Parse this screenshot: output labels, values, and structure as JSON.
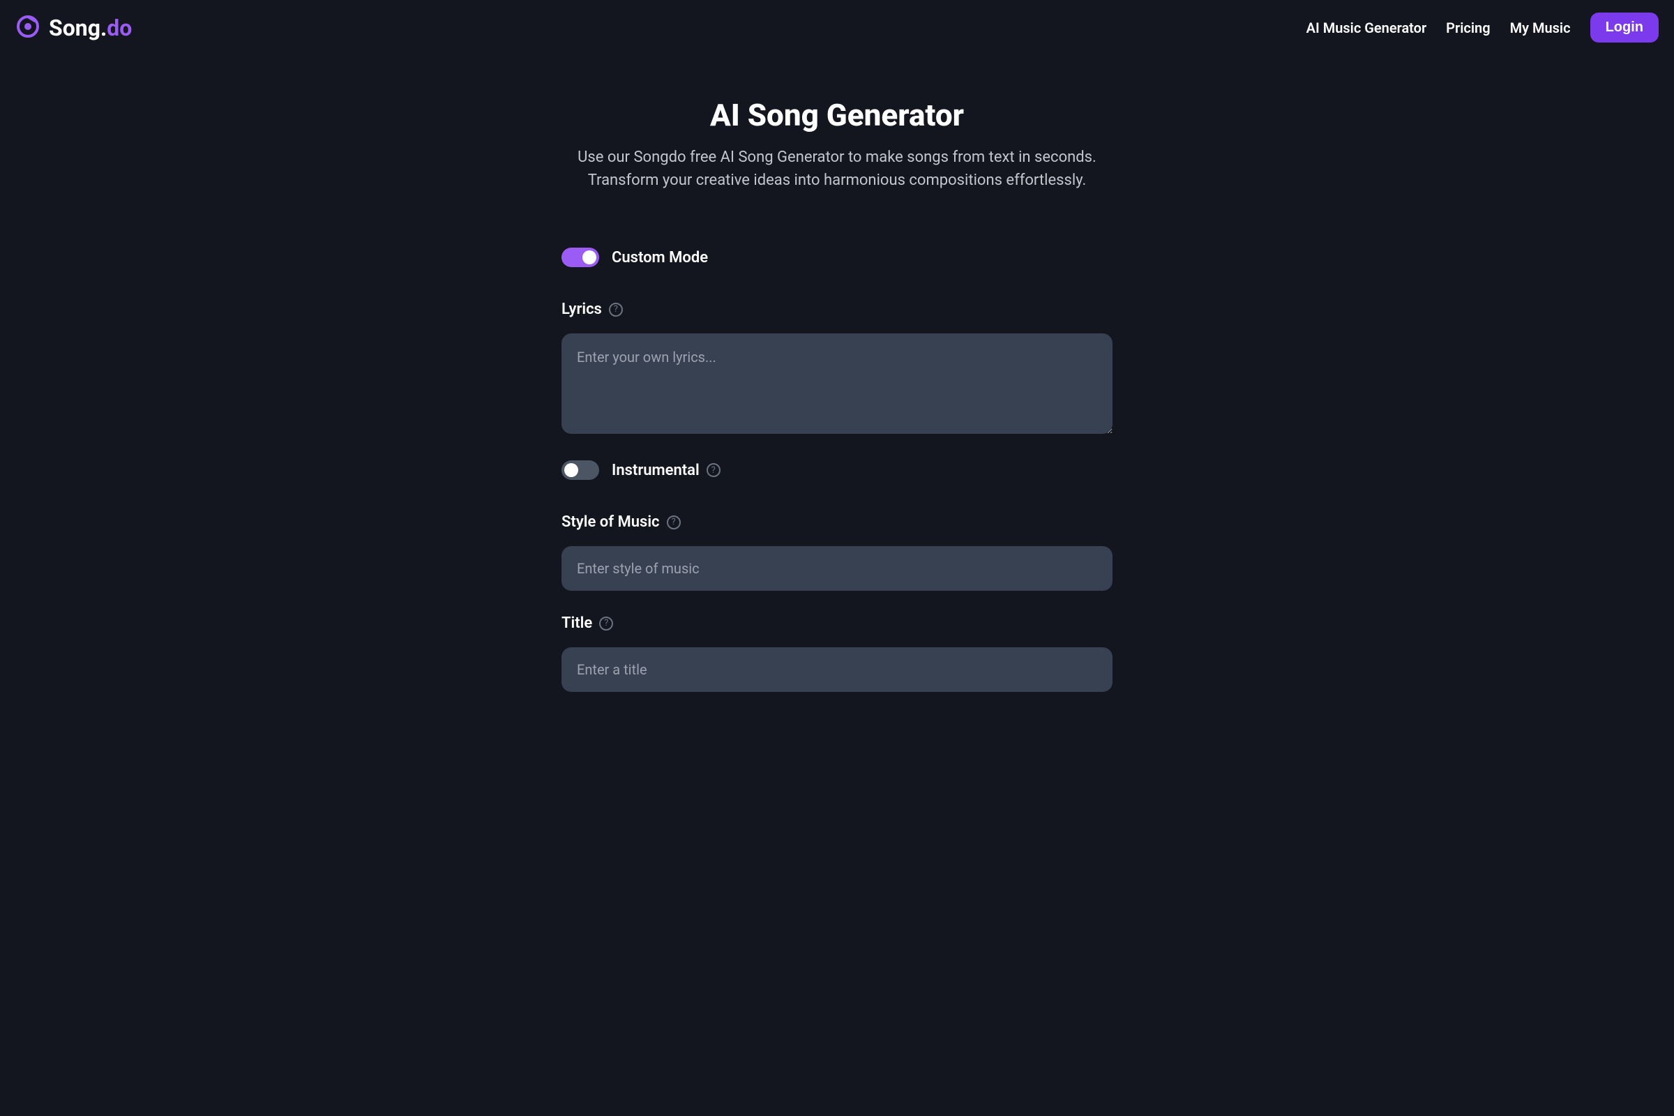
{
  "header": {
    "logo": {
      "text_main": "Song.",
      "text_accent": "do"
    },
    "nav": {
      "ai_generator": "AI Music Generator",
      "pricing": "Pricing",
      "my_music": "My Music",
      "login": "Login"
    }
  },
  "main": {
    "title": "AI Song Generator",
    "subtitle": "Use our Songdo free AI Song Generator to make songs from text in seconds. Transform your creative ideas into harmonious compositions effortlessly."
  },
  "form": {
    "custom_mode": {
      "label": "Custom Mode",
      "enabled": true
    },
    "lyrics": {
      "label": "Lyrics",
      "placeholder": "Enter your own lyrics...",
      "value": ""
    },
    "instrumental": {
      "label": "Instrumental",
      "enabled": false
    },
    "style": {
      "label": "Style of Music",
      "placeholder": "Enter style of music",
      "value": ""
    },
    "title_field": {
      "label": "Title",
      "placeholder": "Enter a title",
      "value": ""
    }
  },
  "colors": {
    "accent": "#9b5cf6",
    "button": "#7c3aed",
    "background": "#14161f",
    "input_bg": "#374151"
  }
}
